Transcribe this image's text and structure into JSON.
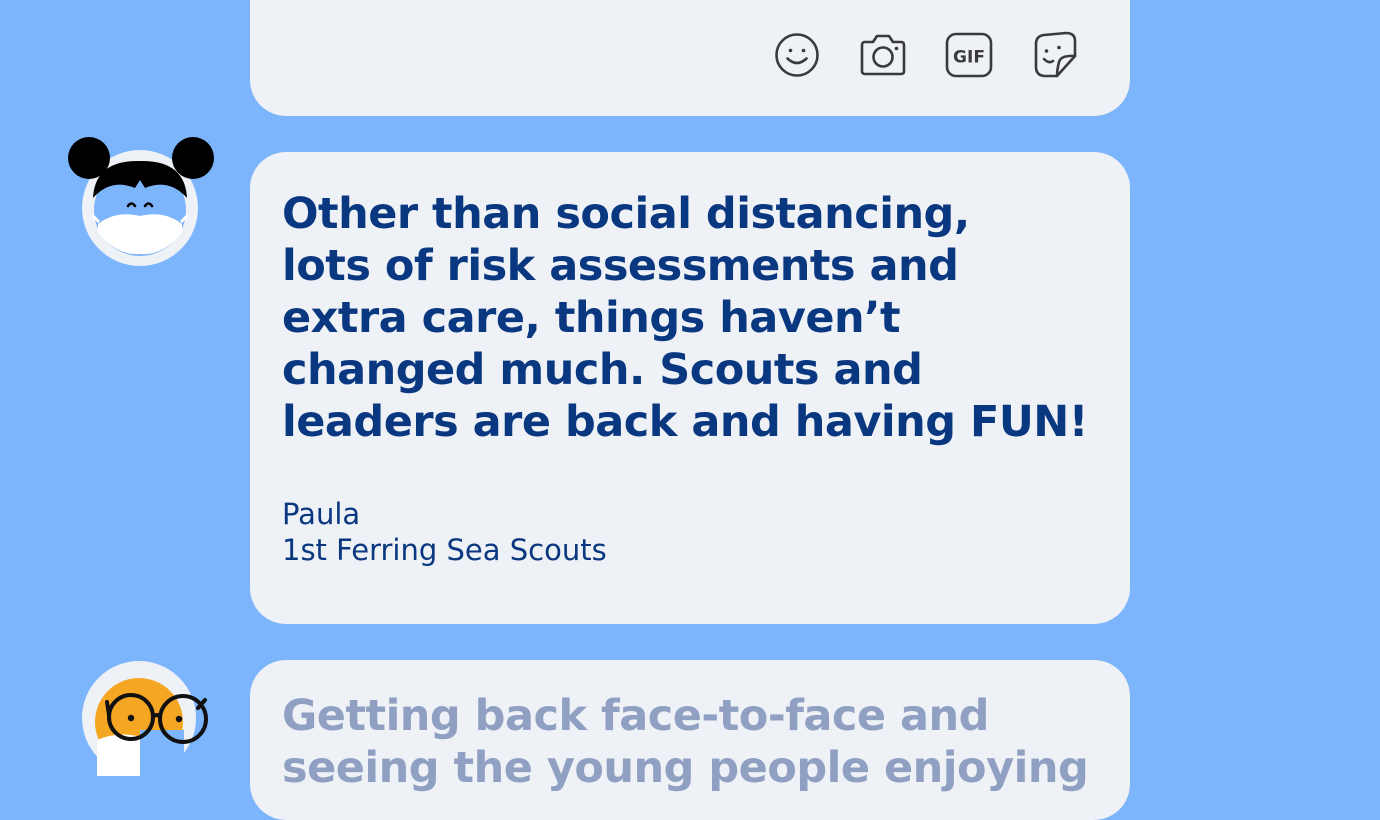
{
  "top_card": {
    "toolbar_icons": [
      "smiley-icon",
      "camera-icon",
      "gif-icon",
      "sticker-icon"
    ],
    "gif_label": "GIF"
  },
  "main_post": {
    "quote_lines": [
      "Other than social distancing,",
      "lots of risk assessments and",
      "extra care, things haven’t",
      "changed much. Scouts and",
      "leaders are back and having FUN!"
    ],
    "author_name": "Paula",
    "author_group": "1st Ferring Sea Scouts"
  },
  "next_post": {
    "quote_lines": [
      "Getting back face-to-face and",
      "seeing the young people enjoying"
    ]
  },
  "colors": {
    "background": "#7cb5fc",
    "card": "#eef1f6",
    "text_primary": "#0a3880",
    "text_faded": "#8fa0c2",
    "avatar_accent": "#f5a623"
  }
}
